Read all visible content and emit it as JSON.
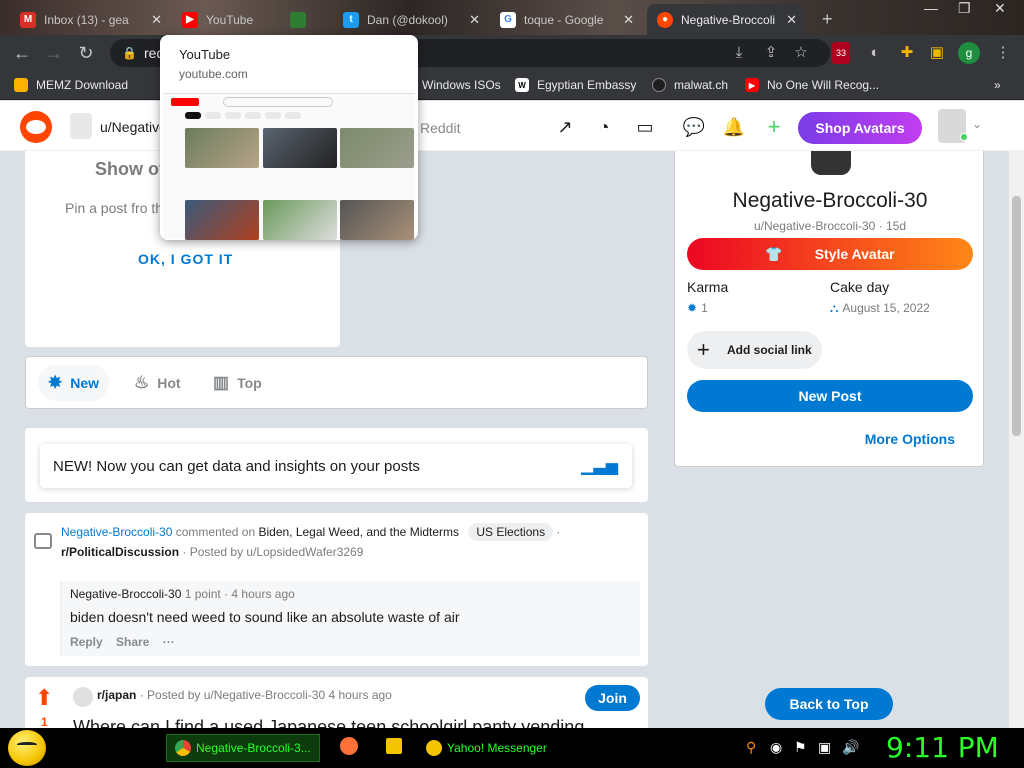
{
  "browser": {
    "tabs": [
      {
        "label": "Inbox (13) - gea",
        "favicon": "gmail-icon"
      },
      {
        "label": "YouTube",
        "favicon": "youtube-icon"
      },
      {
        "label": "",
        "favicon": "generic-icon"
      },
      {
        "label": "Dan (@dokool)",
        "favicon": "twitter-icon"
      },
      {
        "label": "toque - Google",
        "favicon": "google-icon"
      },
      {
        "label": "Negative-Broccoli",
        "favicon": "reddit-icon",
        "active": true
      }
    ],
    "new_tab": "+",
    "address_partial": "red",
    "extension_badge": "33",
    "profile_letter": "g"
  },
  "bookmarks": [
    {
      "label": "MEMZ Download",
      "icon": "memz-icon",
      "color": "#ffb300"
    },
    {
      "label": "Windows ISOs",
      "icon": "windows-icon",
      "color": "#ffb300"
    },
    {
      "label": "Egyptian Embassy",
      "icon": "wix-icon",
      "color": "#000000"
    },
    {
      "label": "malwat.ch",
      "icon": "globe-icon",
      "color": "#1e1e1e"
    },
    {
      "label": "No One Will Recog...",
      "icon": "youtube-icon",
      "color": "#ff0000"
    }
  ],
  "bookmarks_overflow": "»",
  "tab_preview": {
    "title": "YouTube",
    "url": "youtube.com"
  },
  "reddit_header": {
    "user": "u/Negative",
    "search_placeholder": "Reddit",
    "shop_label": "Shop Avatars"
  },
  "pinned": {
    "title": "Show of",
    "desc": "Pin a post fro the \"...\" at the",
    "cta": "OK, I GOT IT"
  },
  "sort": {
    "items": [
      {
        "label": "New",
        "icon": "burst-icon"
      },
      {
        "label": "Hot",
        "icon": "flame-icon"
      },
      {
        "label": "Top",
        "icon": "podium-icon"
      }
    ]
  },
  "insights": {
    "text": "NEW! Now you can get data and insights on your posts"
  },
  "comment": {
    "author": "Negative-Broccoli-30",
    "action": "commented on",
    "post_title": "Biden, Legal Weed, and the Midterms",
    "flair": "US Elections",
    "sep": "·",
    "subreddit": "r/PoliticalDiscussion",
    "posted_by": "· Posted by u/LopsidedWafer3269",
    "reply_author": "Negative-Broccoli-30",
    "reply_meta": "1 point · 4 hours ago",
    "reply_text": "biden doesn't need weed to sound like an absolute waste of air",
    "reply_label": "Reply",
    "share_label": "Share",
    "more_label": "···"
  },
  "post": {
    "votes": "1",
    "subreddit": "r/japan",
    "meta": "· Posted by u/Negative-Broccoli-30 4 hours ago",
    "join_label": "Join",
    "title_partial": "Where can I find a used Japanese teen schoolgirl panty vending"
  },
  "profile": {
    "name": "Negative-Broccoli-30",
    "sub": "u/Negative-Broccoli-30 · 15d",
    "style_label": "Style Avatar",
    "karma_label": "Karma",
    "karma_value": "1",
    "cake_label": "Cake day",
    "cake_value": "August 15, 2022",
    "social_label": "Add social link",
    "newpost_label": "New Post",
    "more_label": "More Options"
  },
  "back_to_top": "Back to Top",
  "taskbar": {
    "tasks": [
      {
        "label": "Negative-Broccoli-3...",
        "icon": "chrome-icon"
      },
      {
        "label": "Yahoo! Messenger",
        "icon": "yahoo-messenger-icon"
      }
    ],
    "clock": "9:11 PM"
  },
  "colors": {
    "reddit_orange": "#ff4500",
    "reddit_blue": "#0079d3",
    "taskbar_green": "#29ff29"
  }
}
